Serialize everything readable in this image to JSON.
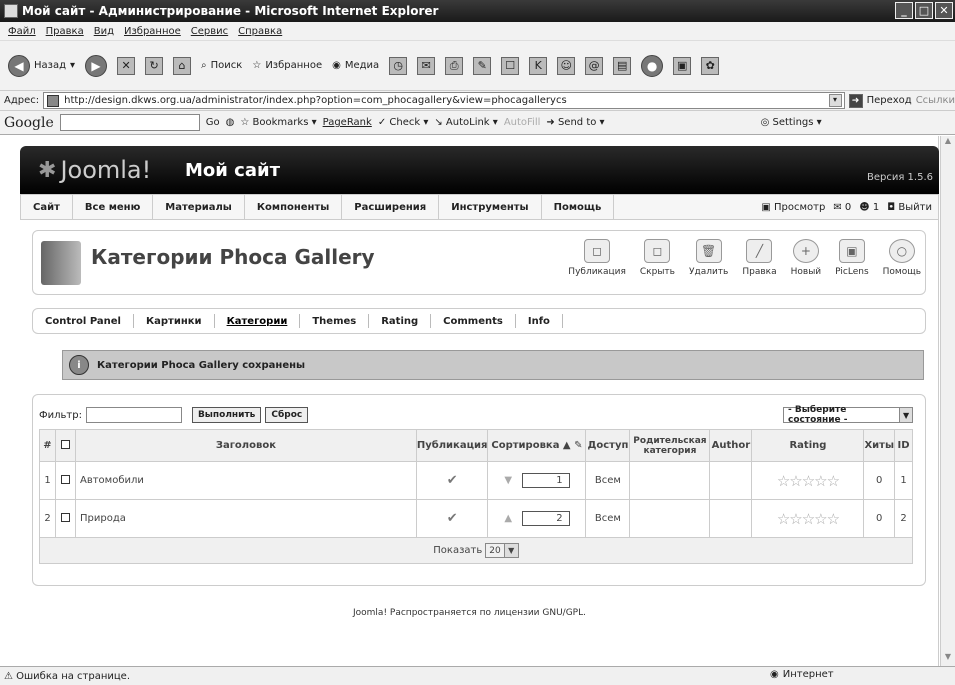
{
  "window": {
    "title": "Мой сайт - Администрирование - Microsoft Internet Explorer",
    "menu": [
      "Файл",
      "Правка",
      "Вид",
      "Избранное",
      "Сервис",
      "Справка"
    ]
  },
  "toolbar": {
    "back": "Назад",
    "search": "Поиск",
    "favorites": "Избранное",
    "media": "Медиа"
  },
  "address": {
    "label": "Адрес:",
    "url": "http://design.dkws.org.ua/administrator/index.php?option=com_phocagallery&view=phocagallerycs",
    "go": "Переход",
    "links": "Ссылки"
  },
  "google": {
    "logo": "Google",
    "go": "Go",
    "bookmarks": "Bookmarks",
    "pagerank": "PageRank",
    "check": "Check",
    "autolink": "AutoLink",
    "autofill": "AutoFill",
    "sendto": "Send to",
    "settings": "Settings"
  },
  "header": {
    "logo": "Joomla!",
    "site": "Мой сайт",
    "version": "Версия 1.5.6"
  },
  "nav": {
    "items": [
      "Сайт",
      "Все меню",
      "Материалы",
      "Компоненты",
      "Расширения",
      "Инструменты",
      "Помощь"
    ],
    "preview": "Просмотр",
    "msgs": "0",
    "users": "1",
    "logout": "Выйти"
  },
  "panel": {
    "title": "Категории Phoca Gallery",
    "tools": [
      "Публикация",
      "Скрыть",
      "Удалить",
      "Правка",
      "Новый",
      "PicLens",
      "Помощь"
    ]
  },
  "subnav": [
    "Control Panel",
    "Картинки",
    "Категории",
    "Themes",
    "Rating",
    "Comments",
    "Info"
  ],
  "message": "Категории Phoca Gallery сохранены",
  "filter": {
    "label": "Фильтр:",
    "value": "",
    "go": "Выполнить",
    "reset": "Сброс",
    "state": "- Выберите состояние -"
  },
  "table": {
    "headers": [
      "#",
      "",
      "Заголовок",
      "Публикация",
      "Сортировка",
      "Доступ",
      "Родительская категория",
      "Author",
      "Rating",
      "Хиты",
      "ID"
    ],
    "rows": [
      {
        "num": "1",
        "title": "Автомобили",
        "order": "1",
        "access": "Всем",
        "parent": "",
        "author": "",
        "hits": "0",
        "id": "1"
      },
      {
        "num": "2",
        "title": "Природа",
        "order": "2",
        "access": "Всем",
        "parent": "",
        "author": "",
        "hits": "0",
        "id": "2"
      }
    ],
    "show_label": "Показать",
    "show_value": "20"
  },
  "footer": "Joomla! Распространяется по лицензии GNU/GPL.",
  "status": {
    "left": "Ошибка на странице.",
    "zone": "Интернет"
  }
}
